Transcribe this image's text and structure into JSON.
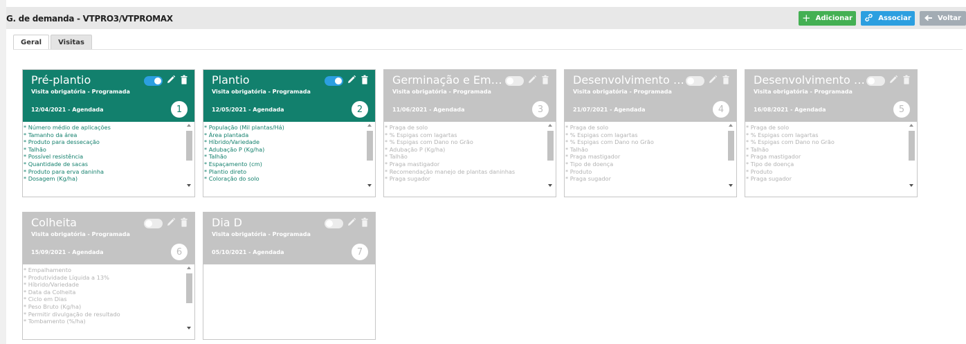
{
  "header": {
    "title": "G. de demanda - VTPRO3/VTPROMAX"
  },
  "actions": {
    "add_label": "Adicionar",
    "associate_label": "Associar",
    "back_label": "Voltar"
  },
  "tabs": [
    {
      "label": "Geral"
    },
    {
      "label": "Visitas"
    }
  ],
  "cards": [
    {
      "title": "Pré-plantio",
      "subtitle": "Visita obrigatória - Programada",
      "date_status": "12/04/2021 - Agendada",
      "number": "1",
      "enabled": true,
      "items": [
        "* Número médio de aplicações",
        "* Tamanho da área",
        "* Produto para dessecação",
        "* Talhão",
        "* Possível resistência",
        "* Quantidade de sacas",
        "* Produto para erva daninha",
        "* Dosagem (Kg/ha)"
      ]
    },
    {
      "title": "Plantio",
      "subtitle": "Visita obrigatória - Programada",
      "date_status": "12/05/2021 - Agendada",
      "number": "2",
      "enabled": true,
      "items": [
        "* População (Mil plantas/Há)",
        "* Área plantada",
        "* Híbrido/Variedade",
        "* Adubação P (Kg/ha)",
        "* Talhão",
        "* Espaçamento (cm)",
        "* Plantio direto",
        "* Coloração do solo"
      ]
    },
    {
      "title": "Germinação e Eme...",
      "subtitle": "Visita obrigatória - Programada",
      "date_status": "11/06/2021 - Agendada",
      "number": "3",
      "enabled": false,
      "items": [
        "* Praga de solo",
        "* % Espigas com lagartas",
        "* % Espigas com Dano no Grão",
        "* Adubação P (Kg/ha)",
        "* Talhão",
        "* Praga mastigador",
        "* Recomendação manejo de plantas daninhas",
        "* Praga sugador"
      ]
    },
    {
      "title": "Desenvolvimento V...",
      "subtitle": "Visita obrigatória - Programada",
      "date_status": "21/07/2021 - Agendada",
      "number": "4",
      "enabled": false,
      "items": [
        "* Praga de solo",
        "* % Espigas com lagartas",
        "* % Espigas com Dano no Grão",
        "* Talhão",
        "* Praga mastigador",
        "* Tipo de doença",
        "* Produto",
        "* Praga sugador"
      ]
    },
    {
      "title": "Desenvolvimento R...",
      "subtitle": "Visita obrigatória - Programada",
      "date_status": "16/08/2021 - Agendada",
      "number": "5",
      "enabled": false,
      "items": [
        "* Praga de solo",
        "* % Espigas com lagartas",
        "* % Espigas com Dano no Grão",
        "* Talhão",
        "* Praga mastigador",
        "* Tipo de doença",
        "* Produto",
        "* Praga sugador"
      ]
    },
    {
      "title": "Colheita",
      "subtitle": "Visita obrigatória - Programada",
      "date_status": "15/09/2021 - Agendada",
      "number": "6",
      "enabled": false,
      "items": [
        "* Empalhamento",
        "* Produtividade Líquida a 13%",
        "* Híbrido/Variedade",
        "* Data da Colheita",
        "* Ciclo em Dias",
        "* Peso Bruto (Kg/ha)",
        "* Permitir divulgação de resultado",
        "* Tombamento (%/ha)"
      ]
    },
    {
      "title": "Dia D",
      "subtitle": "Visita obrigatória - Programada",
      "date_status": "05/10/2021 - Agendada",
      "number": "7",
      "enabled": false,
      "items": []
    }
  ],
  "colors": {
    "active_header": "#12806d",
    "inactive_header": "#c4c4c4",
    "add": "#44b053",
    "associate": "#2c9fe0",
    "back": "#a3acb4"
  }
}
